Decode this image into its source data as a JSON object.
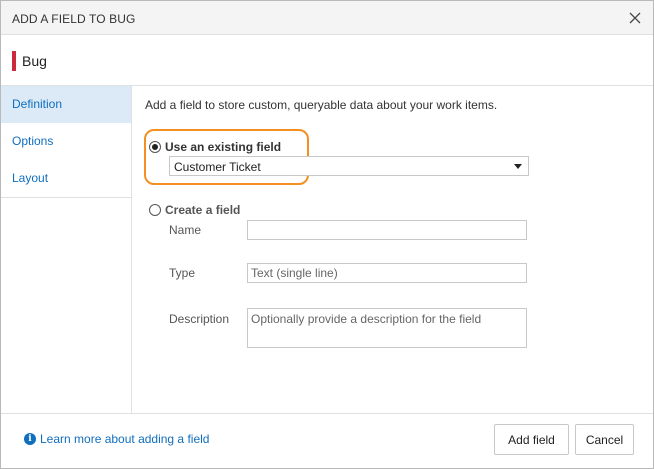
{
  "dialog": {
    "title": "ADD A FIELD TO BUG",
    "close_icon": "close-icon"
  },
  "work_item": {
    "name": "Bug",
    "color": "#cc293d"
  },
  "sidebar": {
    "items": [
      {
        "label": "Definition",
        "selected": true
      },
      {
        "label": "Options",
        "selected": false
      },
      {
        "label": "Layout",
        "selected": false
      }
    ]
  },
  "main": {
    "description": "Add a field to store custom, queryable data about your work items.",
    "existing_option": {
      "label": "Use an existing field",
      "checked": true,
      "selected_value": "Customer Ticket"
    },
    "create_option": {
      "label": "Create a field",
      "checked": false,
      "name_label": "Name",
      "name_value": "",
      "type_label": "Type",
      "type_value": "Text (single line)",
      "description_label": "Description",
      "description_placeholder": "Optionally provide a description for the field"
    },
    "highlight_color": "#f39021"
  },
  "footer": {
    "help_icon": "info-icon",
    "help_link": "Learn more about adding a field",
    "add_label": "Add field",
    "cancel_label": "Cancel"
  }
}
